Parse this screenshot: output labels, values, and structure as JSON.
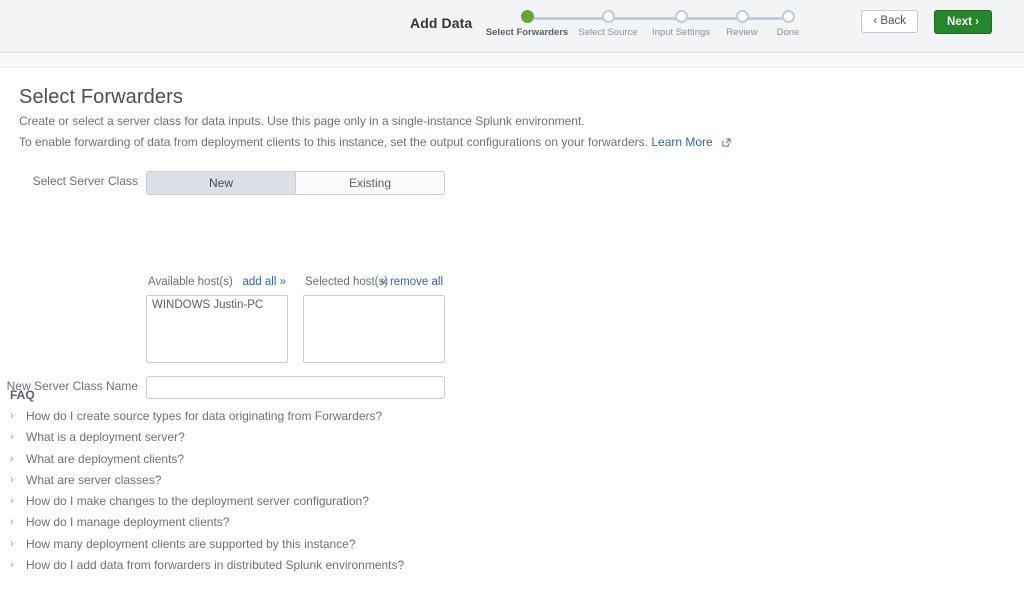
{
  "header": {
    "title": "Add Data",
    "back_label": "‹ Back",
    "next_label": "Next ›",
    "steps": [
      {
        "label": "Select Forwarders",
        "state": "active"
      },
      {
        "label": "Select Source",
        "state": "pending"
      },
      {
        "label": "Input Settings",
        "state": "pending"
      },
      {
        "label": "Review",
        "state": "pending"
      },
      {
        "label": "Done",
        "state": "pending"
      }
    ]
  },
  "main": {
    "page_title": "Select Forwarders",
    "description_1": "Create or select a server class for data inputs. Use this page only in a single-instance Splunk environment.",
    "description_2": "To enable forwarding of data from deployment clients to this instance, set the output configurations on your forwarders.",
    "learn_more_label": "Learn More",
    "server_class": {
      "label": "Select Server Class",
      "options": [
        "New",
        "Existing"
      ],
      "selected": "New"
    },
    "available_hosts": {
      "label": "Available host(s)",
      "action_label": "add all »",
      "items": [
        "WINDOWS  Justin-PC"
      ]
    },
    "selected_hosts": {
      "label": "Selected host(s)",
      "action_label": "« remove all",
      "items": []
    },
    "new_server_class_name": {
      "label": "New Server Class Name",
      "value": "",
      "placeholder": ""
    }
  },
  "faq": {
    "title": "FAQ",
    "items": [
      "How do I create source types for data originating from Forwarders?",
      "What is a deployment server?",
      "What are deployment clients?",
      "What are server classes?",
      "How do I make changes to the deployment server configuration?",
      "How do I manage deployment clients?",
      "How many deployment clients are supported by this instance?",
      "How do I add data from forwarders in distributed Splunk environments?"
    ]
  },
  "colors": {
    "accent_green": "#65a637",
    "button_green": "#25862b",
    "link_blue": "#3863a0",
    "header_bg": "#f2f4f5"
  }
}
